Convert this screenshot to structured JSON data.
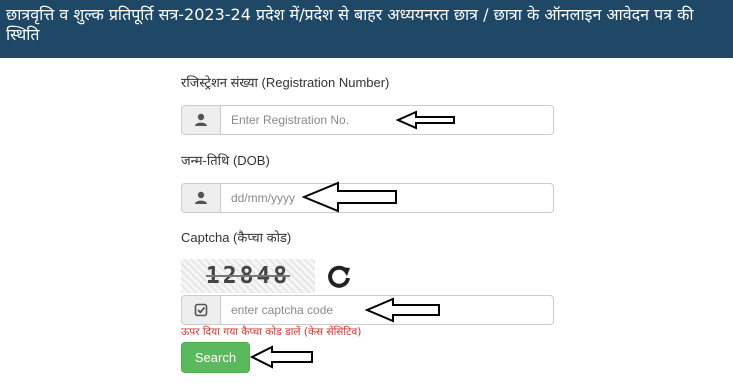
{
  "header": {
    "title": "छात्रवृत्ति व शुल्क प्रतिपूर्ति सत्र-2023-24 प्रदेश में/प्रदेश से बाहर अध्ययनरत छात्र / छात्रा के ऑनलाइन आवेदन पत्र की स्थिति"
  },
  "form": {
    "registration": {
      "label": "रजिस्ट्रेशन संख्या (Registration Number)",
      "placeholder": "Enter Registration No.",
      "icon": "user-icon"
    },
    "dob": {
      "label": "जन्म-तिथि (DOB)",
      "placeholder": "dd/mm/yyyy",
      "icon": "user-icon"
    },
    "captcha": {
      "label": "Captcha (कैप्चा कोड)",
      "image_text": "12848",
      "refresh_icon": "refresh-icon",
      "placeholder": "enter captcha code",
      "icon": "check-square-icon",
      "hint": "ऊपर दिया गया कैप्चा कोड डालें (केस सेंसिटिव)"
    },
    "search_label": "Search"
  },
  "annotations": {
    "arrow_icon": "left-arrow-icon"
  },
  "colors": {
    "header_bg": "#1e4866",
    "button_bg": "#5cb85c",
    "hint_text": "#d9302c"
  }
}
